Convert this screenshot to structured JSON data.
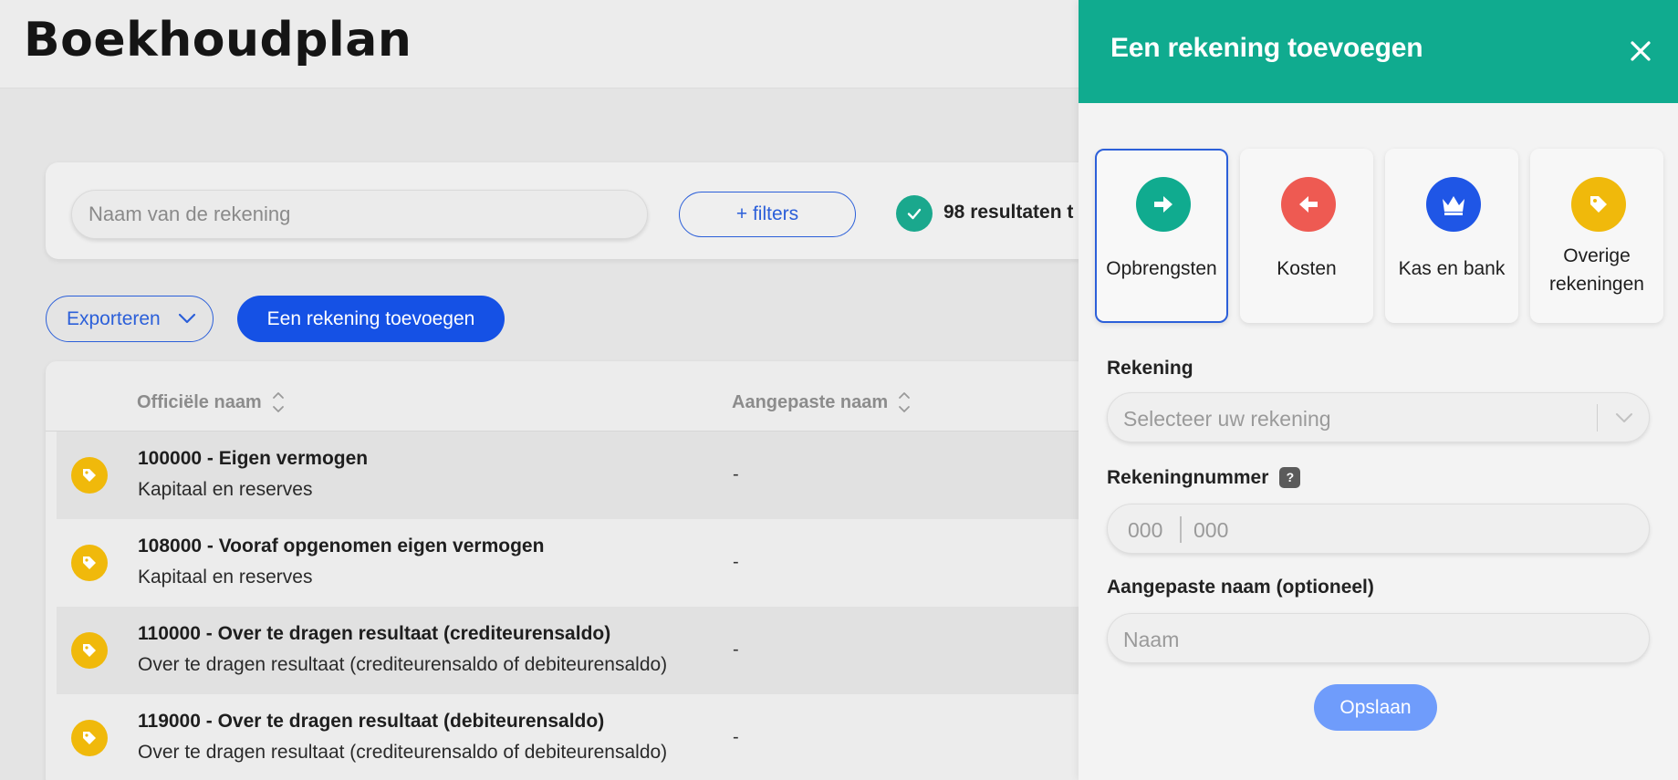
{
  "page": {
    "title": "Boekhoudplan"
  },
  "search": {
    "placeholder": "Naam van de rekening",
    "filters_label": "+ filters",
    "results_text": "98 resultaten t"
  },
  "actions": {
    "export_label": "Exporteren",
    "add_label": "Een rekening toevoegen"
  },
  "table": {
    "columns": [
      "Officiële naam",
      "Aangepaste naam"
    ],
    "rows": [
      {
        "title": "100000 - Eigen vermogen",
        "subtitle": "Kapitaal en reserves",
        "custom": "-"
      },
      {
        "title": "108000 - Vooraf opgenomen eigen vermogen",
        "subtitle": "Kapitaal en reserves",
        "custom": "-"
      },
      {
        "title": "110000 - Over te dragen resultaat (crediteurensaldo)",
        "subtitle": "Over te dragen resultaat (crediteurensaldo of debiteurensaldo)",
        "custom": "-"
      },
      {
        "title": "119000 - Over te dragen resultaat (debiteurensaldo)",
        "subtitle": "Over te dragen resultaat (crediteurensaldo of debiteurensaldo)",
        "custom": "-"
      }
    ],
    "row_icon": "tag-icon"
  },
  "drawer": {
    "title": "Een rekening toevoegen",
    "close_icon": "close-icon",
    "types": [
      {
        "label": "Opbrengsten",
        "icon": "arrow-right-icon",
        "color": "#10ab8f",
        "selected": true
      },
      {
        "label": "Kosten",
        "icon": "arrow-left-icon",
        "color": "#ee5a52",
        "selected": false
      },
      {
        "label": "Kas en bank",
        "icon": "crown-icon",
        "color": "#1f56e6",
        "selected": false
      },
      {
        "label_line1": "Overige",
        "label_line2": "rekeningen",
        "icon": "tag-icon",
        "color": "#f0b90b",
        "selected": false
      }
    ],
    "account_label": "Rekening",
    "account_placeholder": "Selecteer uw rekening",
    "number_label": "Rekeningnummer",
    "number_help": "?",
    "number_part1_placeholder": "000",
    "number_part2_placeholder": "000",
    "custom_name_label": "Aangepaste naam (optioneel)",
    "custom_name_placeholder": "Naam",
    "save_label": "Opslaan"
  },
  "colors": {
    "accent_green": "#10ab8f",
    "primary_blue": "#1551e5",
    "save_disabled": "#6f9cfb",
    "tag_yellow": "#f0b90b",
    "cost_red": "#ee5a52"
  }
}
